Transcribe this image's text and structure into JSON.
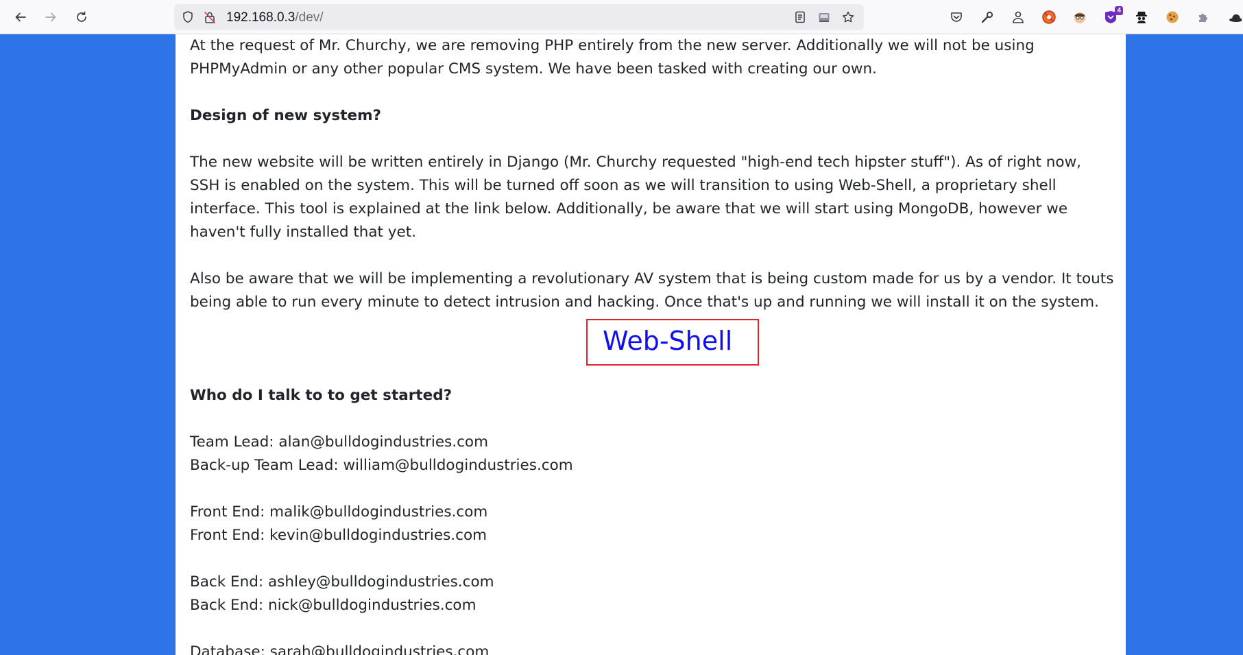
{
  "browser": {
    "url_host": "192.168.0.3",
    "url_path": "/dev/"
  },
  "extensions": {
    "badge_count": "4"
  },
  "page": {
    "intro": "At the request of Mr. Churchy, we are removing PHP entirely from the new server. Additionally we will not be using PHPMyAdmin or any other popular CMS system. We have been tasked with creating our own.",
    "design_heading": "Design of new system?",
    "design_paragraph": "The new website will be written entirely in Django (Mr. Churchy requested \"high-end tech hipster stuff\"). As of right now, SSH is enabled on the system. This will be turned off soon as we will transition to using Web-Shell, a proprietary shell interface. This tool is explained at the link below. Additionally, be aware that we will start using MongoDB, however we haven't fully installed that yet.",
    "av_paragraph": "Also be aware that we will be implementing a revolutionary AV system that is being custom made for us by a vendor. It touts being able to run every minute to detect intrusion and hacking. Once that's up and running we will install it on the system.",
    "webshell_link": "Web-Shell",
    "contacts_heading": "Who do I talk to to get started?",
    "contacts": {
      "team_lead": "Team Lead: alan@bulldogindustries.com",
      "backup_lead": "Back-up Team Lead: william@bulldogindustries.com",
      "front_end_1": "Front End: malik@bulldogindustries.com",
      "front_end_2": "Front End: kevin@bulldogindustries.com",
      "back_end_1": "Back End: ashley@bulldogindustries.com",
      "back_end_2": "Back End: nick@bulldogindustries.com",
      "database": "Database: sarah@bulldogindustries.com"
    }
  },
  "colors": {
    "page_background": "#2f73e8",
    "content_background": "#ffffff",
    "link": "#1010ef",
    "highlight_box": "#e0242c"
  }
}
